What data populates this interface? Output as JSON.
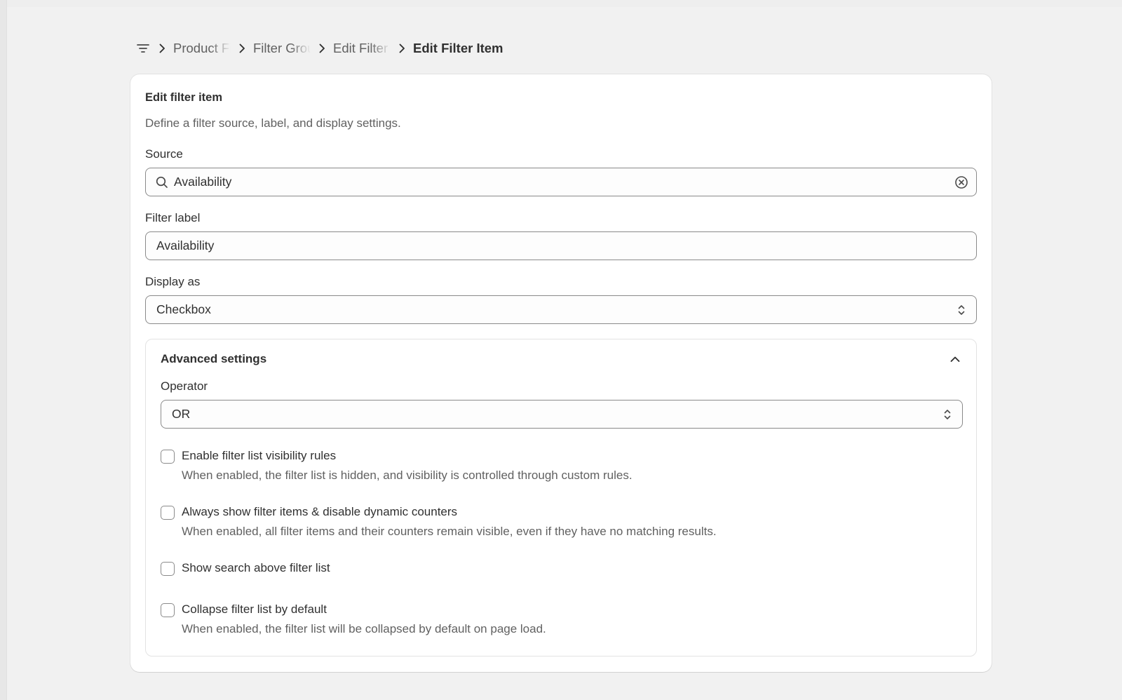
{
  "breadcrumb": {
    "items": [
      "Product Filters",
      "Filter Groups",
      "Edit Filter"
    ],
    "current": "Edit Filter Item"
  },
  "card": {
    "title": "Edit filter item",
    "description": "Define a filter source, label, and display settings."
  },
  "source": {
    "label": "Source",
    "value": "Availability"
  },
  "filter_label": {
    "label": "Filter label",
    "value": "Availability"
  },
  "display_as": {
    "label": "Display as",
    "value": "Checkbox"
  },
  "advanced": {
    "title": "Advanced settings",
    "operator_label": "Operator",
    "operator_value": "OR",
    "options": [
      {
        "label": "Enable filter list visibility rules",
        "help": "When enabled, the filter list is hidden, and visibility is controlled through custom rules.",
        "checked": false
      },
      {
        "label": "Always show filter items & disable dynamic counters",
        "help": "When enabled, all filter items and their counters remain visible, even if they have no matching results.",
        "checked": false
      },
      {
        "label": "Show search above filter list",
        "help": "",
        "checked": false
      },
      {
        "label": "Collapse filter list by default",
        "help": "When enabled, the filter list will be collapsed by default on page load.",
        "checked": false
      }
    ]
  },
  "icons": {
    "breadcrumb_menu": "filter-lines-icon",
    "separator": "chevron-right-icon",
    "search": "search-icon",
    "clear": "clear-circle-x-icon",
    "select": "select-updown-icon",
    "collapse": "chevron-up-icon"
  },
  "colors": {
    "background": "#f1f1f1",
    "card": "#ffffff",
    "text": "#303030",
    "muted": "#616161",
    "border": "#8a8a8a"
  }
}
